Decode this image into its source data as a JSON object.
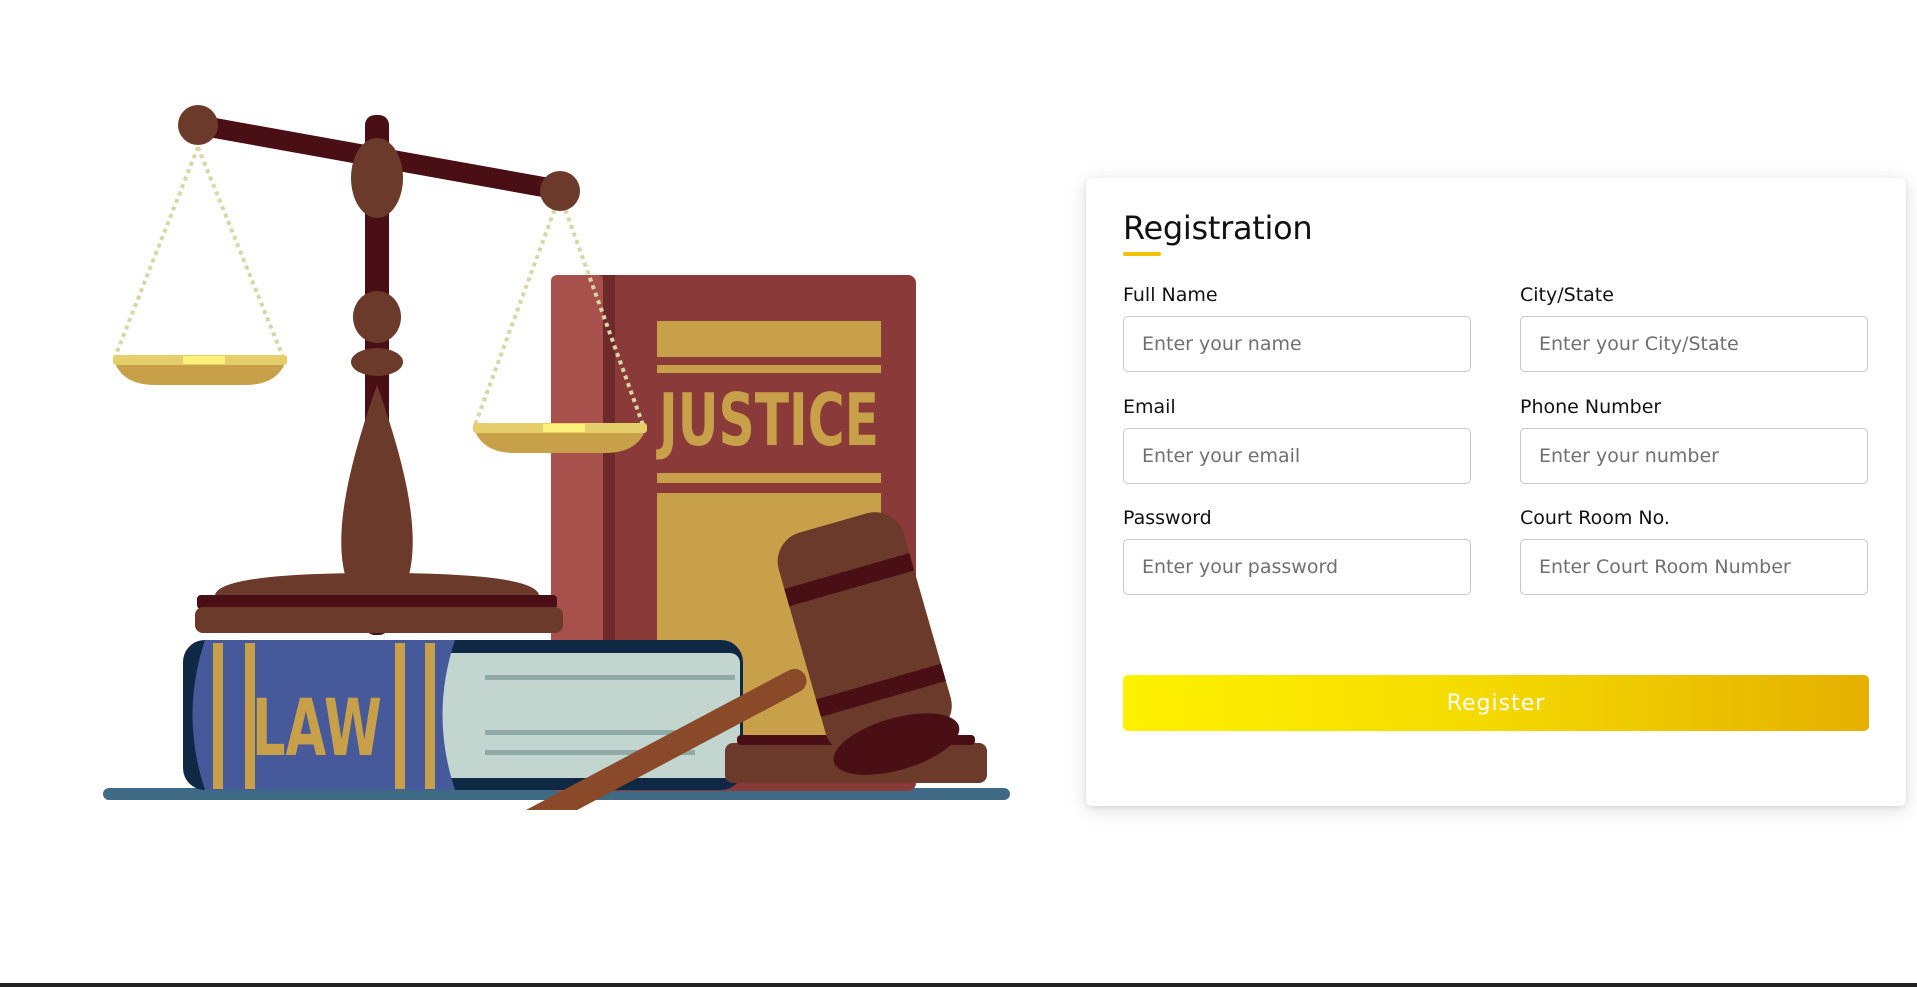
{
  "illustration": {
    "book_upright_label": "JUSTICE",
    "book_lying_label": "LAW"
  },
  "form": {
    "title": "Registration",
    "fields": [
      {
        "label": "Full Name",
        "placeholder": "Enter your name"
      },
      {
        "label": "City/State",
        "placeholder": "Enter your City/State"
      },
      {
        "label": "Email",
        "placeholder": "Enter your email"
      },
      {
        "label": "Phone Number",
        "placeholder": "Enter your number"
      },
      {
        "label": "Password",
        "placeholder": "Enter your password"
      },
      {
        "label": "Court Room No.",
        "placeholder": "Enter Court Room Number"
      }
    ],
    "submit_label": "Register"
  },
  "colors": {
    "accent": "#f2c200",
    "button_gradient_start": "#fff200",
    "button_gradient_end": "#e5b000",
    "scale_brown": "#6b3a2a",
    "scale_dark": "#4a0f14",
    "book_red": "#8a3a38",
    "book_gold": "#c9a04a",
    "book_blue": "#46599a"
  },
  "icons": [
    "scales-of-justice-icon",
    "gavel-icon",
    "justice-book-icon",
    "law-book-icon"
  ]
}
